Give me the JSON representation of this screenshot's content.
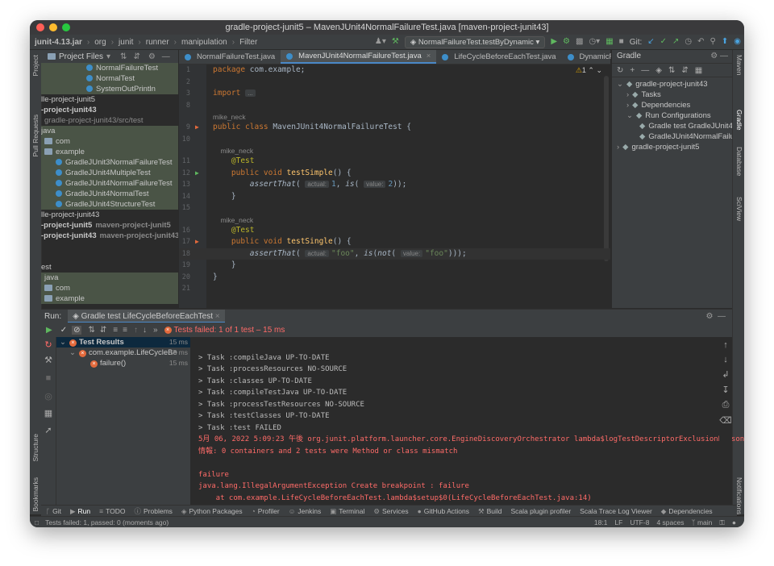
{
  "window": {
    "title": "gradle-project-junit5 – MavenJUnit4NormalFailureTest.java [maven-project-junit43]"
  },
  "colors": {
    "close": "#fe5f57",
    "minimize": "#febc2e",
    "maximize": "#28c840",
    "accent": "#4a88c7",
    "fail": "#e36a3c",
    "run": "#5fb85f"
  },
  "toolbar": {
    "crumbs": [
      "junit-4.13.jar",
      "org",
      "junit",
      "runner",
      "manipulation",
      "Filter"
    ],
    "run_config": "NormalFailureTest.testByDynamic",
    "git_label": "Git:"
  },
  "left_tools": [
    "Project",
    "Pull Requests",
    "Structure",
    "Bookmarks"
  ],
  "right_tools": [
    "Maven",
    "Gradle",
    "Database",
    "SciView",
    "Notifications"
  ],
  "project": {
    "header": "Project Files",
    "rows": [
      {
        "text": "NormalFailureTest",
        "dim": "",
        "kind": "class",
        "indent": 56,
        "hl": true,
        "bold": false
      },
      {
        "text": "NormalTest",
        "dim": "",
        "kind": "class",
        "indent": 56,
        "hl": true,
        "bold": false
      },
      {
        "text": "SystemOutPrintln",
        "dim": "",
        "kind": "class",
        "indent": 56,
        "hl": true,
        "bold": false
      },
      {
        "text": "lle-project-junit5",
        "dim": "",
        "kind": "",
        "indent": 0,
        "hl": false,
        "bold": false
      },
      {
        "text": "-project-junit43",
        "dim": "",
        "kind": "",
        "indent": 0,
        "hl": false,
        "bold": true
      },
      {
        "text": "gradle-project-junit43/src/test",
        "dim": "",
        "kind": "",
        "indent": 4,
        "hl": false,
        "bold": false,
        "gray": true
      },
      {
        "text": "java",
        "dim": "",
        "kind": "",
        "indent": 0,
        "hl": true,
        "bold": false
      },
      {
        "text": "com",
        "dim": "",
        "kind": "folder",
        "indent": 4,
        "hl": true,
        "bold": false
      },
      {
        "text": "example",
        "dim": "",
        "kind": "folder",
        "indent": 4,
        "hl": true,
        "bold": false
      },
      {
        "text": "GradleJUnit3NormalFailureTest",
        "dim": "",
        "kind": "class",
        "indent": 18,
        "hl": true,
        "bold": false
      },
      {
        "text": "GradleJUnit4MultipleTest",
        "dim": "",
        "kind": "class",
        "indent": 18,
        "hl": true,
        "bold": false
      },
      {
        "text": "GradleJUnit4NormalFailureTest",
        "dim": "",
        "kind": "class",
        "indent": 18,
        "hl": true,
        "bold": false
      },
      {
        "text": "GradleJUnit4NormalTest",
        "dim": "",
        "kind": "class",
        "indent": 18,
        "hl": true,
        "bold": false
      },
      {
        "text": "GradleJUnit4StructureTest",
        "dim": "",
        "kind": "class",
        "indent": 18,
        "hl": true,
        "bold": false
      },
      {
        "text": "lle-project-junit43",
        "dim": "",
        "kind": "",
        "indent": 0,
        "hl": false,
        "bold": false
      },
      {
        "text": "-project-junit5",
        "dim": "maven-project-junit5",
        "kind": "",
        "indent": 0,
        "hl": false,
        "bold": true
      },
      {
        "text": "-project-junit43",
        "dim": "maven-project-junit43",
        "kind": "",
        "indent": 0,
        "hl": false,
        "bold": true
      },
      {
        "text": "",
        "dim": "",
        "kind": "",
        "indent": 0,
        "hl": false,
        "bold": false
      },
      {
        "text": "",
        "dim": "",
        "kind": "",
        "indent": 0,
        "hl": false,
        "bold": false
      },
      {
        "text": "est",
        "dim": "",
        "kind": "",
        "indent": 0,
        "hl": false,
        "bold": false
      },
      {
        "text": "java",
        "dim": "",
        "kind": "",
        "indent": 4,
        "hl": true,
        "bold": false
      },
      {
        "text": "com",
        "dim": "",
        "kind": "folder",
        "indent": 4,
        "hl": true,
        "bold": false
      },
      {
        "text": "example",
        "dim": "",
        "kind": "folder",
        "indent": 4,
        "hl": true,
        "bold": false
      }
    ]
  },
  "tabs": [
    {
      "label": "NormalFailureTest.java",
      "active": false
    },
    {
      "label": "MavenJUnit4NormalFailureTest.java",
      "active": true
    },
    {
      "label": "LifeCycleBeforeEachTest.java",
      "active": false
    },
    {
      "label": "DynamicFailureTest.java",
      "active": false
    }
  ],
  "editor": {
    "warning_count": "1",
    "lines": [
      {
        "n": "1",
        "html": "<span class='kw'>package</span> com.example;"
      },
      {
        "n": "2",
        "html": ""
      },
      {
        "n": "3",
        "html": "<span class='kw'>import</span> <span class='ph'>...</span>"
      },
      {
        "n": "8",
        "html": ""
      },
      {
        "n": "",
        "hint": "mike_neck"
      },
      {
        "n": "9",
        "html": "<span class='kw'>public class</span> MavenJUnit4NormalFailureTest {"
      },
      {
        "n": "10",
        "html": ""
      },
      {
        "n": "",
        "hint": "    mike_neck"
      },
      {
        "n": "11",
        "html": "    <span class='ann'>@Test</span>"
      },
      {
        "n": "12",
        "html": "    <span class='kw'>public void</span> <span class='fn'>testSimple</span>() {"
      },
      {
        "n": "13",
        "html": "        <span class='it'>assertThat</span>( <span class='ph'>actual:</span><span class='num'>1</span>, <span class='it'>is</span>( <span class='ph'>value:</span><span class='num'>2</span>));"
      },
      {
        "n": "14",
        "html": "    }"
      },
      {
        "n": "15",
        "html": ""
      },
      {
        "n": "",
        "hint": "    mike_neck"
      },
      {
        "n": "16",
        "html": "    <span class='ann'>@Test</span>"
      },
      {
        "n": "17",
        "html": "    <span class='kw'>public void</span> <span class='fn'>testSingle</span>() {"
      },
      {
        "n": "18",
        "html": "        <span class='it'>assertThat</span>( <span class='ph'>actual:</span><span class='str'>\"foo\"</span>, <span class='it'>is</span>(<span class='it'>not</span>( <span class='ph'>value:</span><span class='str'>\"foo\"</span>)));",
        "current": true
      },
      {
        "n": "19",
        "html": "    }"
      },
      {
        "n": "20",
        "html": "}"
      },
      {
        "n": "21",
        "html": ""
      }
    ]
  },
  "gradle": {
    "header": "Gradle",
    "rows": [
      {
        "text": "gradle-project-junit43",
        "indent": 6,
        "arrow": "v"
      },
      {
        "text": "Tasks",
        "indent": 18,
        "arrow": ">"
      },
      {
        "text": "Dependencies",
        "indent": 18,
        "arrow": ">"
      },
      {
        "text": "Run Configurations",
        "indent": 18,
        "arrow": "v"
      },
      {
        "text": "Gradle test GradleJUnit4",
        "indent": 34,
        "arrow": ""
      },
      {
        "text": "GradleJUnit4NormalFailu",
        "indent": 34,
        "arrow": ""
      },
      {
        "text": "gradle-project-junit5",
        "indent": 6,
        "arrow": ">"
      }
    ]
  },
  "run": {
    "label": "Run:",
    "tab": "Gradle test LifeCycleBeforeEachTest",
    "status": "Tests failed: 1 of 1 test – 15 ms",
    "results": [
      {
        "text": "Test Results",
        "time": "15 ms",
        "indent": 4,
        "bold": true
      },
      {
        "text": "com.example.LifeCycleBe",
        "time": "15 ms",
        "indent": 16,
        "bold": false
      },
      {
        "text": "failure()",
        "time": "15 ms",
        "indent": 42,
        "bold": false
      }
    ],
    "console": [
      {
        "text": "",
        "red": false
      },
      {
        "text": "> Task :compileJava UP-TO-DATE",
        "red": false
      },
      {
        "text": "> Task :processResources NO-SOURCE",
        "red": false
      },
      {
        "text": "> Task :classes UP-TO-DATE",
        "red": false
      },
      {
        "text": "> Task :compileTestJava UP-TO-DATE",
        "red": false
      },
      {
        "text": "> Task :processTestResources NO-SOURCE",
        "red": false
      },
      {
        "text": "> Task :testClasses UP-TO-DATE",
        "red": false
      },
      {
        "text": "> Task :test FAILED",
        "red": false
      },
      {
        "text": "5月 06, 2022 5:09:23 午後 org.junit.platform.launcher.core.EngineDiscoveryOrchestrator lambda$logTestDescriptorExclusionReasons",
        "red": true
      },
      {
        "text": "情報: 0 containers and 2 tests were Method or class mismatch",
        "red": true
      },
      {
        "text": "",
        "red": false
      },
      {
        "text": "failure",
        "red": true
      },
      {
        "text": "java.lang.IllegalArgumentException Create breakpoint : failure",
        "red": true
      },
      {
        "text": "    at com.example.LifeCycleBeforeEachTest.lambda$setup$0(LifeCycleBeforeEachTest.java:14)",
        "red": true
      }
    ]
  },
  "status_tabs": [
    "Git",
    "Run",
    "TODO",
    "Problems",
    "Python Packages",
    "Profiler",
    "Jenkins",
    "Terminal",
    "Services",
    "GitHub Actions",
    "Build",
    "Scala plugin profiler",
    "Scala Trace Log Viewer",
    "Dependencies"
  ],
  "bottom": {
    "message": "Tests failed: 1, passed: 0 (moments ago)",
    "position": "18:1",
    "line_sep": "LF",
    "encoding": "UTF-8",
    "indent": "4 spaces",
    "branch": "main"
  }
}
